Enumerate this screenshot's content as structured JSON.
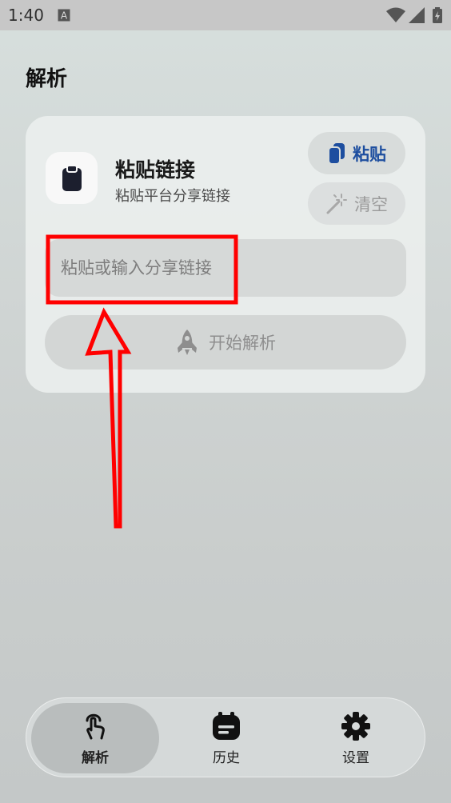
{
  "status_bar": {
    "time": "1:40",
    "icons": [
      "a-notification-icon",
      "wifi-icon",
      "signal-icon",
      "battery-charging-icon"
    ]
  },
  "page": {
    "title": "解析"
  },
  "card": {
    "icon": "clipboard-icon",
    "title": "粘贴链接",
    "subtitle": "粘贴平台分享链接",
    "paste_button": {
      "label": "粘贴",
      "icon": "paste-icon"
    },
    "clear_button": {
      "label": "清空",
      "icon": "magic-wand-icon"
    },
    "link_input": {
      "value": "",
      "placeholder": "粘贴或输入分享链接"
    },
    "start_button": {
      "label": "开始解析",
      "icon": "rocket-icon"
    }
  },
  "bottom_nav": {
    "items": [
      {
        "label": "解析",
        "icon": "tap-hand-icon",
        "active": true
      },
      {
        "label": "历史",
        "icon": "history-icon",
        "active": false
      },
      {
        "label": "设置",
        "icon": "gear-icon",
        "active": false
      }
    ]
  },
  "colors": {
    "accent": "#1d4e9f",
    "annotation": "#ff0000"
  }
}
